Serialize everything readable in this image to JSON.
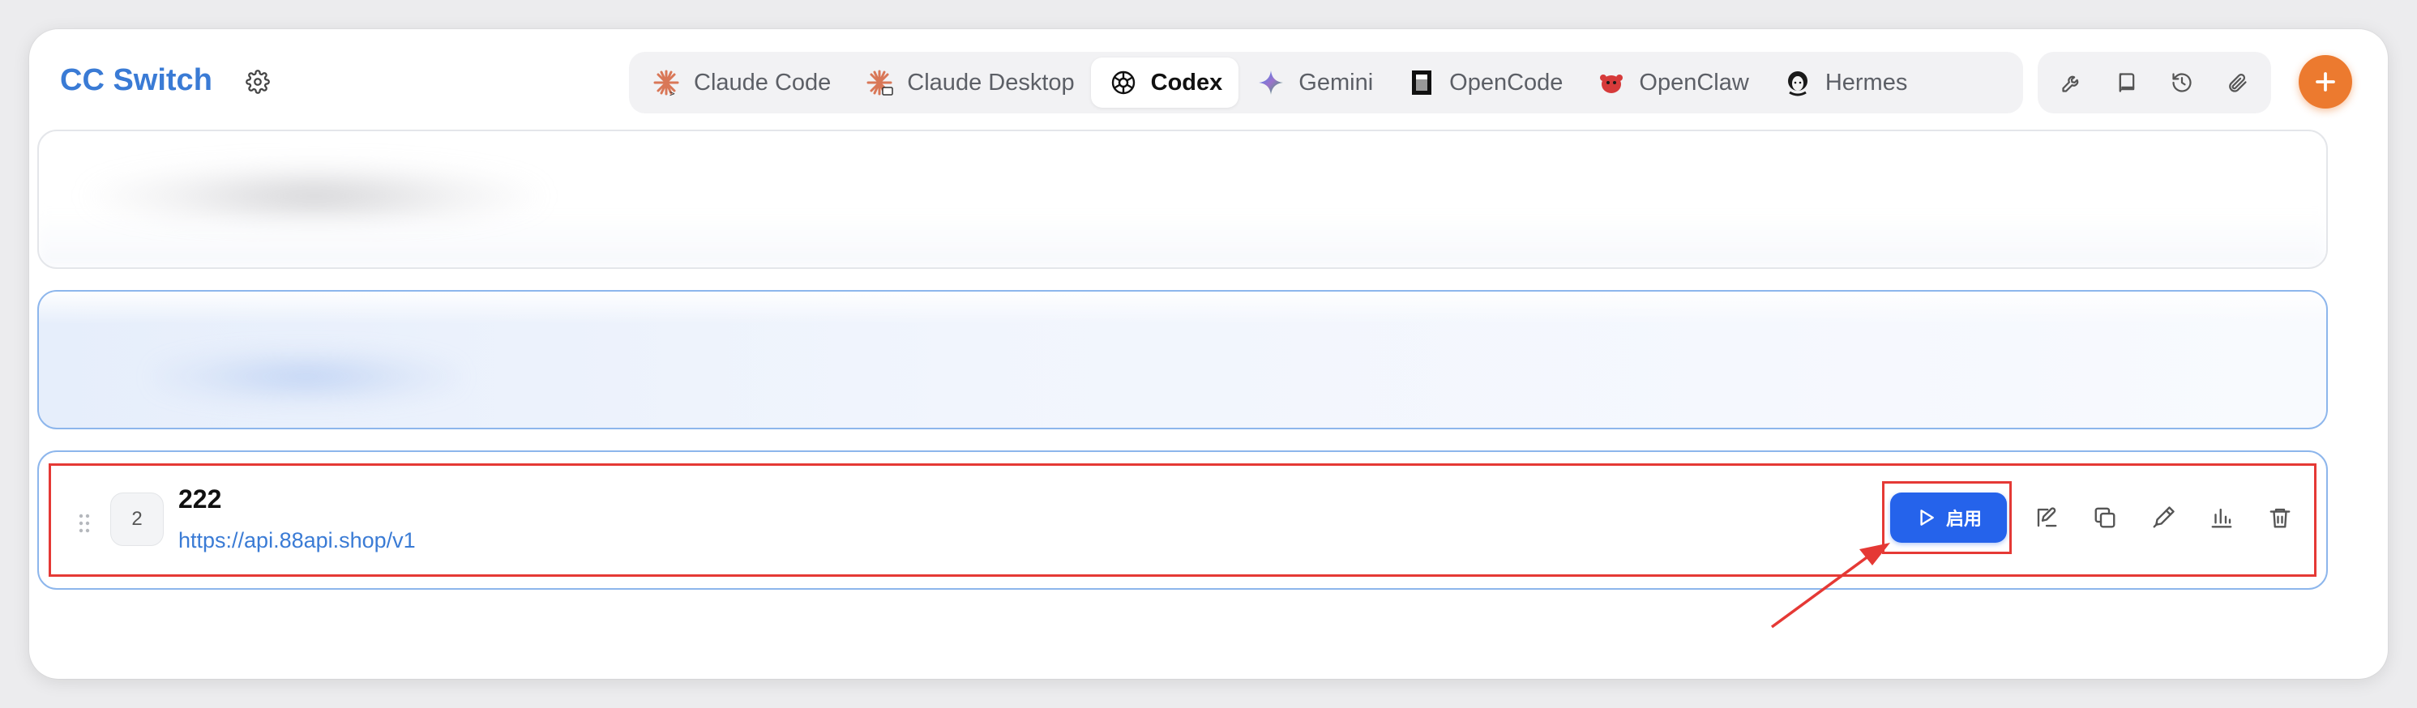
{
  "app": {
    "title": "CC Switch"
  },
  "tabs": [
    {
      "label": "Claude Code",
      "icon": "claude-code-icon",
      "active": false
    },
    {
      "label": "Claude Desktop",
      "icon": "claude-desktop-icon",
      "active": false
    },
    {
      "label": "Codex",
      "icon": "codex-icon",
      "active": true
    },
    {
      "label": "Gemini",
      "icon": "gemini-icon",
      "active": false
    },
    {
      "label": "OpenCode",
      "icon": "opencode-icon",
      "active": false
    },
    {
      "label": "OpenClaw",
      "icon": "openclaw-icon",
      "active": false
    },
    {
      "label": "Hermes",
      "icon": "hermes-icon",
      "active": false
    }
  ],
  "toolbar": {
    "icons": [
      "wrench-icon",
      "book-icon",
      "history-icon",
      "paperclip-icon"
    ],
    "add_icon": "plus-icon"
  },
  "provider": {
    "index": "2",
    "name": "222",
    "url": "https://api.88api.shop/v1",
    "enable_label": "启用",
    "actions": [
      "edit-icon",
      "duplicate-icon",
      "test-icon",
      "usage-chart-icon",
      "delete-icon"
    ]
  },
  "colors": {
    "brand": "#3a7bd5",
    "accent_add": "#ec7a2f",
    "enable_button": "#2563eb",
    "annotation_red": "#e53935",
    "active_card_border": "#8db6ec"
  }
}
